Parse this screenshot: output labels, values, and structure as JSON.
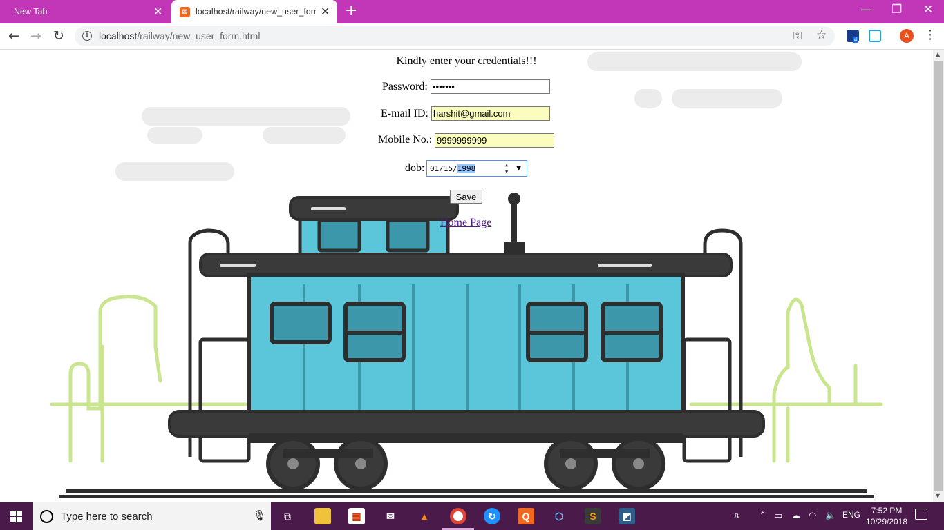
{
  "browser": {
    "tabs": [
      {
        "title": "New Tab",
        "active": false
      },
      {
        "title": "localhost/railway/new_user_form",
        "active": true
      }
    ],
    "url_host": "localhost",
    "url_path": "/railway/new_user_form.html",
    "profile_initial": "A",
    "extension_badge": "4"
  },
  "page": {
    "heading": "Kindly enter your credentials!!!",
    "password_label": "Password:",
    "password_value": "•••••••",
    "email_label": "E-mail ID:",
    "email_value": "harshit@gmail.com",
    "mobile_label": "Mobile No.:",
    "mobile_value": "9999999999",
    "dob_label": "dob:",
    "dob_month": "01",
    "dob_day": "15",
    "dob_year": "1998",
    "save_label": "Save",
    "home_link": "Home Page"
  },
  "taskbar": {
    "search_placeholder": "Type here to search",
    "language": "ENG",
    "time": "7:52 PM",
    "date": "10/29/2018"
  }
}
